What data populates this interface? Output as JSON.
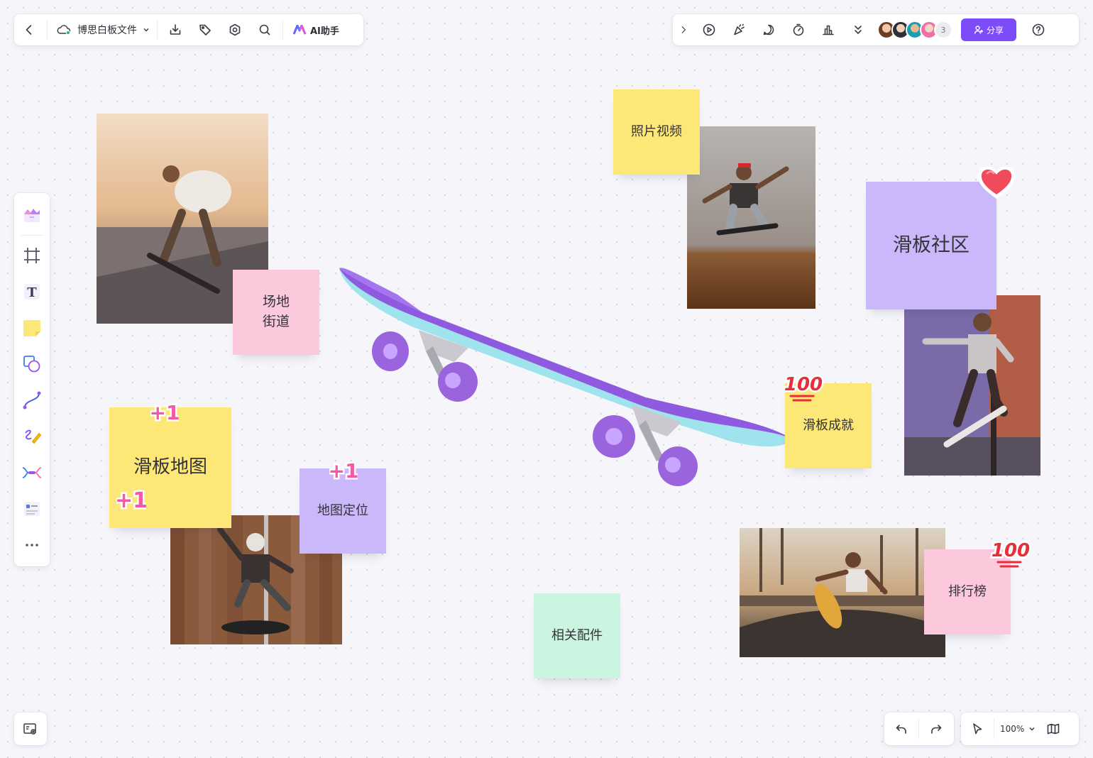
{
  "file": {
    "name": "博思白板文件",
    "ai_label": "AI助手"
  },
  "collab": {
    "extra_count": "3",
    "share_label": "分享"
  },
  "zoom": {
    "value": "100%"
  },
  "notes": {
    "venue": "场地\n街道",
    "photo_video": "照片视频",
    "community": "滑板社区",
    "map": "滑板地图",
    "location": "地图定位",
    "achievement": "滑板成就",
    "accessories": "相关配件",
    "ranking": "排行榜"
  },
  "stickers": {
    "plus_one": "+1",
    "hundred": "100"
  },
  "colors": {
    "accent": "#7b4cf7",
    "sticky_yellow": "#fde776",
    "sticky_pink": "#fbc8dc",
    "sticky_purple": "#cbb8fb",
    "sticky_green": "#ccf5e1",
    "deck_purple": "#8d5ae0",
    "deck_cyan": "#9fe4ec"
  }
}
